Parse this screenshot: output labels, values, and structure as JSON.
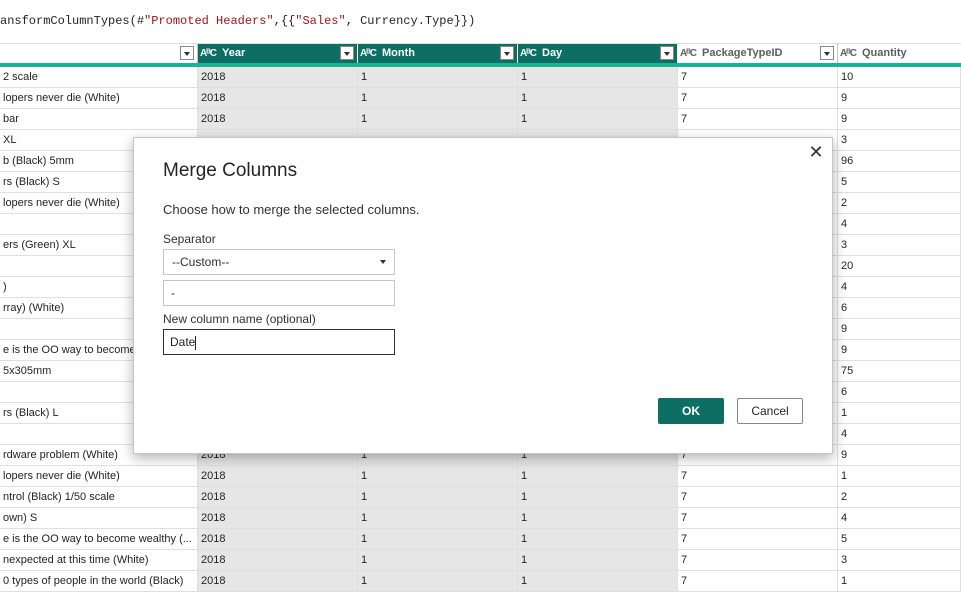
{
  "formula_bar": {
    "prefix": "ansformColumnTypes(#",
    "string1": "\"Promoted Headers\"",
    "middle": ",{{",
    "string2": "\"Sales\"",
    "suffix": ", Currency.Type}})"
  },
  "columns": [
    {
      "name": "",
      "type_icon": "",
      "selected": false
    },
    {
      "name": "Year",
      "type_icon": "AᴮC",
      "selected": true
    },
    {
      "name": "Month",
      "type_icon": "AᴮC",
      "selected": true
    },
    {
      "name": "Day",
      "type_icon": "AᴮC",
      "selected": true
    },
    {
      "name": "PackageTypeID",
      "type_icon": "AᴮC",
      "selected": false
    },
    {
      "name": "Quantity",
      "type_icon": "AᴮC",
      "selected": false
    }
  ],
  "rows": [
    {
      "desc": "2 scale",
      "year": "2018",
      "month": "1",
      "day": "1",
      "pkg": "7",
      "qty": "10"
    },
    {
      "desc": "lopers never die (White)",
      "year": "2018",
      "month": "1",
      "day": "1",
      "pkg": "7",
      "qty": "9"
    },
    {
      "desc": "bar",
      "year": "2018",
      "month": "1",
      "day": "1",
      "pkg": "7",
      "qty": "9"
    },
    {
      "desc": "XL",
      "year": "",
      "month": "",
      "day": "",
      "pkg": "",
      "qty": "3"
    },
    {
      "desc": "b (Black) 5mm",
      "year": "",
      "month": "",
      "day": "",
      "pkg": "",
      "qty": "96"
    },
    {
      "desc": "rs (Black) S",
      "year": "",
      "month": "",
      "day": "",
      "pkg": "",
      "qty": "5"
    },
    {
      "desc": "lopers never die (White)",
      "year": "",
      "month": "",
      "day": "",
      "pkg": "",
      "qty": "2"
    },
    {
      "desc": "",
      "year": "",
      "month": "",
      "day": "",
      "pkg": "",
      "qty": "4"
    },
    {
      "desc": "ers (Green) XL",
      "year": "",
      "month": "",
      "day": "",
      "pkg": "",
      "qty": "3"
    },
    {
      "desc": "",
      "year": "",
      "month": "",
      "day": "",
      "pkg": "",
      "qty": "20"
    },
    {
      "desc": ")",
      "year": "",
      "month": "",
      "day": "",
      "pkg": "",
      "qty": "4"
    },
    {
      "desc": "rray) (White)",
      "year": "",
      "month": "",
      "day": "",
      "pkg": "",
      "qty": "6"
    },
    {
      "desc": "",
      "year": "",
      "month": "",
      "day": "",
      "pkg": "",
      "qty": "9"
    },
    {
      "desc": "e is the OO way to become",
      "year": "",
      "month": "",
      "day": "",
      "pkg": "",
      "qty": "9"
    },
    {
      "desc": "5x305mm",
      "year": "",
      "month": "",
      "day": "",
      "pkg": "",
      "qty": "75"
    },
    {
      "desc": "",
      "year": "",
      "month": "",
      "day": "",
      "pkg": "",
      "qty": "6"
    },
    {
      "desc": "rs (Black) L",
      "year": "",
      "month": "",
      "day": "",
      "pkg": "",
      "qty": "1"
    },
    {
      "desc": "",
      "year": "",
      "month": "",
      "day": "",
      "pkg": "",
      "qty": "4"
    },
    {
      "desc": "rdware problem (White)",
      "year": "2018",
      "month": "1",
      "day": "1",
      "pkg": "7",
      "qty": "9"
    },
    {
      "desc": "lopers never die (White)",
      "year": "2018",
      "month": "1",
      "day": "1",
      "pkg": "7",
      "qty": "1"
    },
    {
      "desc": "ntrol (Black) 1/50 scale",
      "year": "2018",
      "month": "1",
      "day": "1",
      "pkg": "7",
      "qty": "2"
    },
    {
      "desc": "own) S",
      "year": "2018",
      "month": "1",
      "day": "1",
      "pkg": "7",
      "qty": "4"
    },
    {
      "desc": "e is the OO way to become wealthy (...",
      "year": "2018",
      "month": "1",
      "day": "1",
      "pkg": "7",
      "qty": "5"
    },
    {
      "desc": "nexpected at this time (White)",
      "year": "2018",
      "month": "1",
      "day": "1",
      "pkg": "7",
      "qty": "3"
    },
    {
      "desc": "0 types of people in the world (Black)",
      "year": "2018",
      "month": "1",
      "day": "1",
      "pkg": "7",
      "qty": "1"
    }
  ],
  "dialog": {
    "title": "Merge Columns",
    "description": "Choose how to merge the selected columns.",
    "separator_label": "Separator",
    "separator_value": "--Custom--",
    "custom_separator_value": "-",
    "new_column_label": "New column name (optional)",
    "new_column_value": "Date",
    "ok_label": "OK",
    "cancel_label": "Cancel",
    "close_icon": "close-icon"
  },
  "colors": {
    "accent": "#0d6e63",
    "quality_bar": "#1ab394",
    "selected_cell_bg": "#e6e6e6"
  }
}
